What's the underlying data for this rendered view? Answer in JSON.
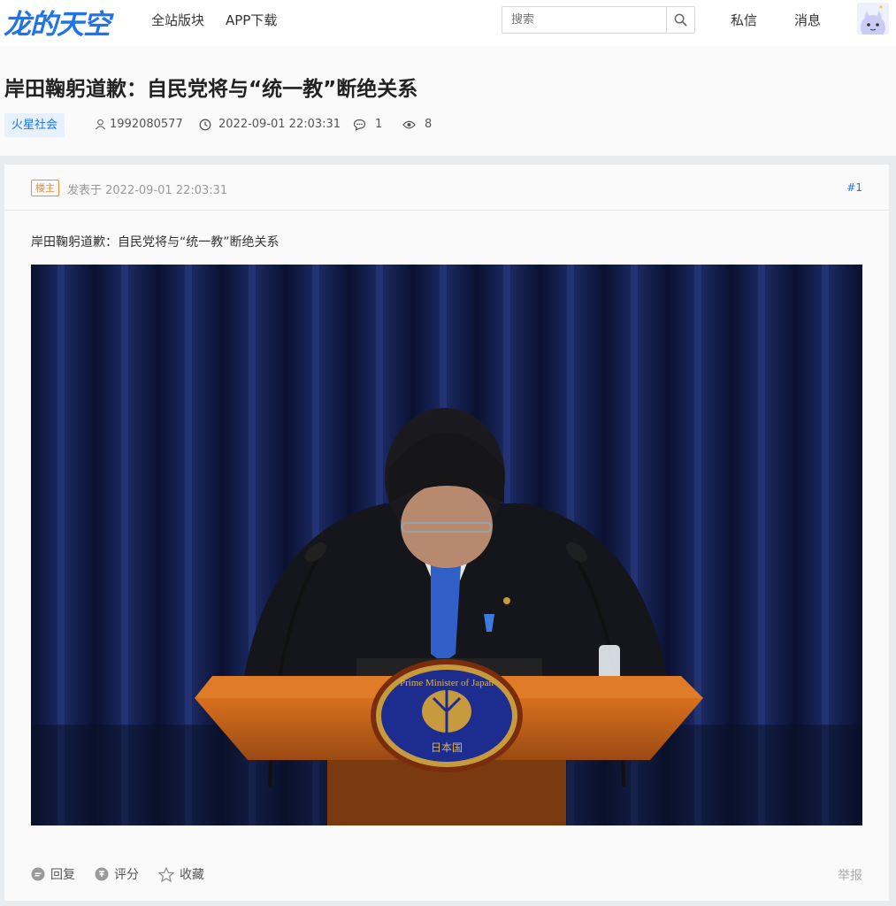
{
  "nav": {
    "logo": "龙的天空",
    "links": [
      "全站版块",
      "APP下载"
    ],
    "search_placeholder": "搜索",
    "messages": "私信",
    "notifications": "消息"
  },
  "post": {
    "title": "岸田鞠躬道歉：自民党将与“统一教”断绝关系",
    "category": "火星社会",
    "author": "1992080577",
    "datetime": "2022-09-01 22:03:31",
    "comments": "1",
    "views": "8"
  },
  "floor": {
    "owner_badge": "楼主",
    "posted_at": "发表于 2022-09-01 22:03:31",
    "number": "#1",
    "content": "岸田鞠躬道歉：自民党将与“统一教”断绝关系"
  },
  "photo": {
    "seal_text_top": "Prime Minister of Japan",
    "seal_text_bottom": "日本国"
  },
  "actions": {
    "reply": "回复",
    "rate": "评分",
    "favorite": "收藏",
    "report": "举报"
  },
  "icons": {
    "search": "search-icon",
    "user": "user-icon",
    "clock": "clock-icon",
    "comment": "comment-icon",
    "eye": "eye-icon",
    "reply": "reply-icon",
    "rate": "rate-icon",
    "star": "star-icon"
  },
  "colors": {
    "brand": "#1e73e8",
    "owner_badge": "#ee8a3c"
  }
}
